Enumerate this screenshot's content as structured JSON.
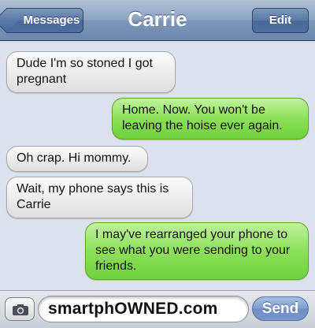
{
  "header": {
    "back_label": "Messages",
    "title": "Carrie",
    "edit_label": "Edit"
  },
  "messages": [
    {
      "direction": "incoming",
      "text": "Dude I'm so stoned I got pregnant"
    },
    {
      "direction": "outgoing",
      "text": "Home. Now. You won't be leaving the hoise ever again."
    },
    {
      "direction": "incoming",
      "text": "Oh crap. Hi mommy."
    },
    {
      "direction": "incoming",
      "text": "Wait, my phone says this is Carrie"
    },
    {
      "direction": "outgoing",
      "text": "I may've rearranged your phone to see what you were sending to your friends."
    }
  ],
  "composer": {
    "camera_icon": "camera-icon",
    "field_value": "smartphOWNED.com",
    "send_label": "Send"
  },
  "colors": {
    "incoming_bubble": "#ececec",
    "outgoing_bubble": "#8ee05a",
    "background": "#dbe2ed",
    "navbar": "#8ca3c2"
  }
}
